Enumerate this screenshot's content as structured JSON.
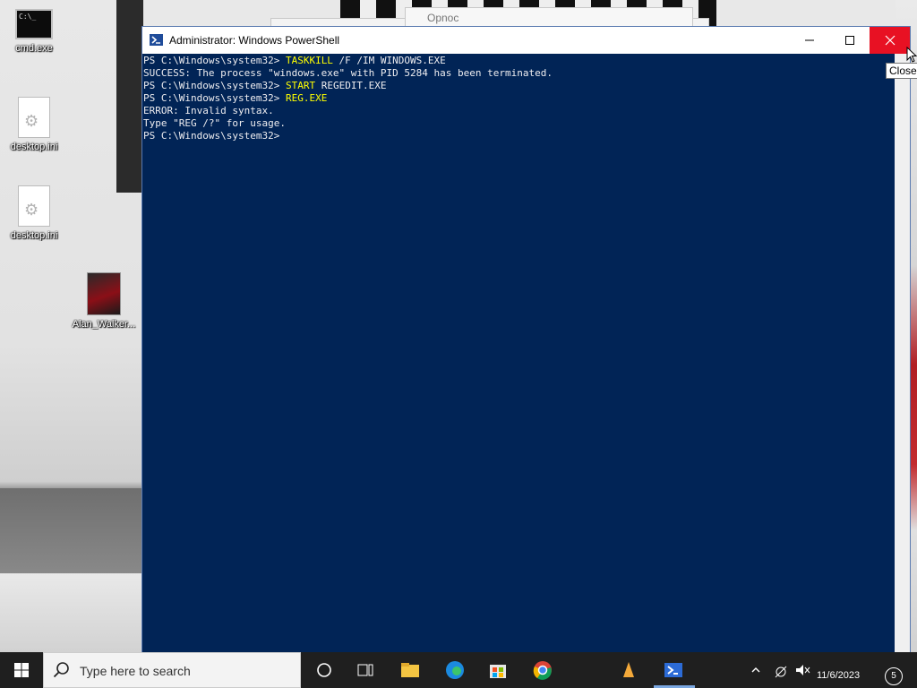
{
  "desktop": {
    "icons": [
      {
        "label": "cmd.exe",
        "glyph": "C:\\_"
      },
      {
        "label": "desktop.ini"
      },
      {
        "label": "desktop.ini"
      },
      {
        "label": "Alan_Walker..."
      }
    ],
    "background_window_title": "Opnoc"
  },
  "window": {
    "title": "Administrator: Windows PowerShell",
    "controls": {
      "minimize": "minimize",
      "maximize": "maximize",
      "close": "close"
    },
    "colors": {
      "console_bg": "#012456",
      "command": "#ffff00",
      "text": "#eeedf0",
      "close_hover": "#e81123"
    }
  },
  "console": {
    "lines": [
      {
        "prompt": "PS C:\\Windows\\system32> ",
        "cmd": "TASKKILL",
        "rest": " /F /IM WINDOWS.EXE"
      },
      {
        "text": "SUCCESS: The process \"windows.exe\" with PID 5284 has been terminated."
      },
      {
        "prompt": "PS C:\\Windows\\system32> ",
        "cmd": "START",
        "rest": " REGEDIT.EXE"
      },
      {
        "prompt": "PS C:\\Windows\\system32> ",
        "cmd": "REG.EXE",
        "rest": ""
      },
      {
        "text": "ERROR: Invalid syntax."
      },
      {
        "text": "Type \"REG /?\" for usage."
      },
      {
        "prompt": "PS C:\\Windows\\system32> ",
        "cmd": "",
        "rest": ""
      }
    ]
  },
  "tooltip": {
    "text": "Close"
  },
  "taskbar": {
    "search_placeholder": "Type here to search",
    "date": "11/6/2023",
    "notifications": "5"
  }
}
